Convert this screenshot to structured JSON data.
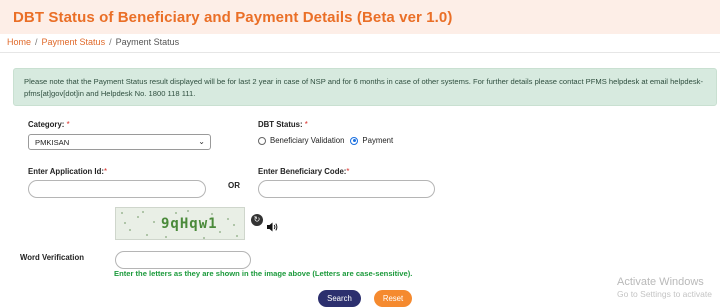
{
  "header": {
    "title": "DBT Status of Beneficiary and Payment Details (Beta ver 1.0)"
  },
  "breadcrumb": {
    "home": "Home",
    "separator": "/",
    "payment_status_link": "Payment Status",
    "current": "Payment Status"
  },
  "notice": {
    "text": "Please note that the Payment Status result displayed will be for last 2 year in case of NSP and for 6 months in case of other systems. For further details please contact PFMS helpdesk at email helpdesk-pfms[at]gov[dot]in and Helpdesk No. 1800 118 111."
  },
  "form": {
    "category_label": "Category:",
    "required_mark": "*",
    "category_value": "PMKISAN",
    "dbt_status_label": "DBT Status:",
    "dbt_options": [
      {
        "label": "Beneficiary Validation",
        "checked": false
      },
      {
        "label": "Payment",
        "checked": true
      }
    ],
    "application_id_label": "Enter Application Id:",
    "or_text": "OR",
    "beneficiary_code_label": "Enter Beneficiary Code:",
    "word_verification_label": "Word Verification",
    "captcha_text": "9qHqw1",
    "captcha_hint": "Enter the letters as they are shown in the image above (Letters are case-sensitive).",
    "search_button": "Search",
    "reset_button": "Reset"
  },
  "system_overlay": {
    "line1": "Activate Windows",
    "line2": "Go to Settings to activate"
  },
  "colors": {
    "title": "#ea6f27",
    "title_bg": "#fdeee7",
    "notice_bg": "#d7eadf",
    "hint": "#1b9a3b",
    "search_button": "#2c2f6e",
    "reset_button": "#f58a2f"
  }
}
